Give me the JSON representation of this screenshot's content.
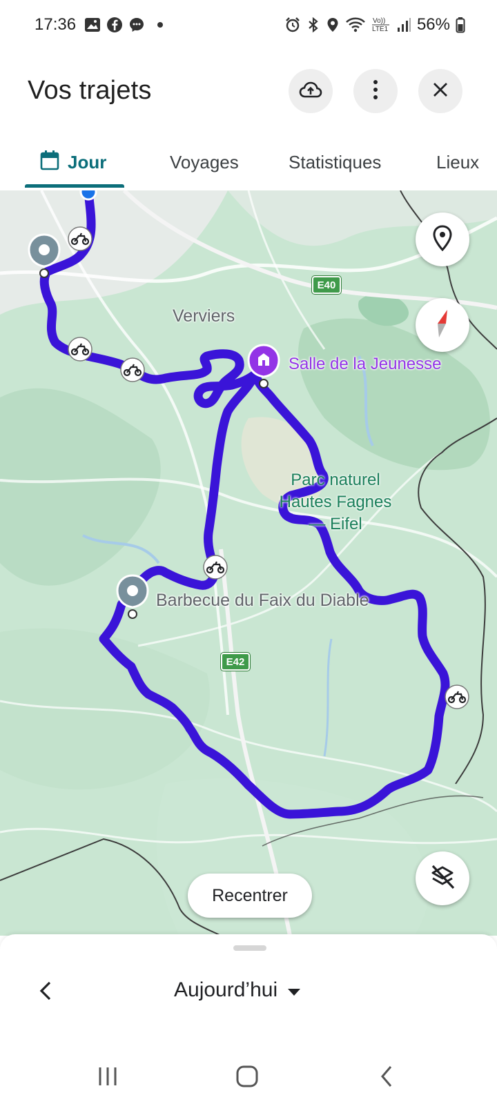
{
  "status_bar": {
    "time": "17:36",
    "battery": "56%",
    "left_icons": [
      "gallery-icon",
      "facebook-icon",
      "messenger-icon",
      "dot-icon"
    ],
    "right_icons": [
      "alarm-icon",
      "bluetooth-icon",
      "location-icon",
      "wifi-icon",
      "volte-icon",
      "signal-icon",
      "battery-icon"
    ],
    "volte_text": "Vo))\nLTE1"
  },
  "header": {
    "title": "Vos trajets",
    "buttons": [
      "upload-icon",
      "more-icon",
      "close-icon"
    ]
  },
  "tabs": [
    {
      "label": "Jour",
      "active": true,
      "icon": "calendar-icon"
    },
    {
      "label": "Voyages",
      "active": false
    },
    {
      "label": "Statistiques",
      "active": false
    },
    {
      "label": "Lieux",
      "active": false
    }
  ],
  "map": {
    "city_label": "Verviers",
    "road_e40": "E40",
    "road_e42": "E42",
    "poi_salle": "Salle de la Jeunesse",
    "poi_barbecue": "Barbecue du Faix du Diable",
    "park_line1": "Parc naturel",
    "park_line2": "Hautes Fagnes",
    "park_line3": "— Eifel",
    "recenter_label": "Recentrer",
    "route_color": "#3a14d8",
    "accent_color": "#0b6e7a",
    "poi_color": "#9334e6"
  },
  "bottom_sheet": {
    "date_label": "Aujourd’hui"
  }
}
